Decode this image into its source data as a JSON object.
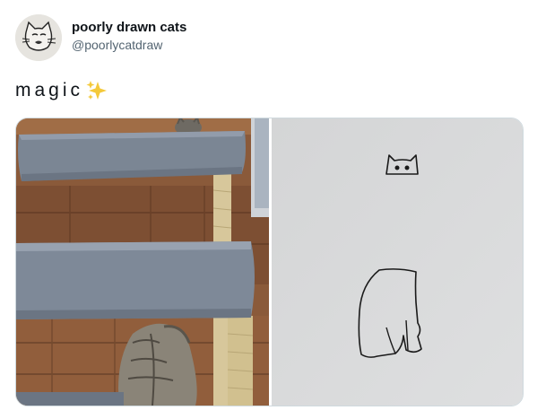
{
  "author": {
    "display_name": "poorly drawn cats",
    "handle": "@poorlycatdraw",
    "avatar_icon": "cat-face-drawing-icon"
  },
  "tweet": {
    "text": "magic",
    "emoji_icon": "sparkles-icon"
  },
  "media": {
    "left_photo": "cat-tree-photo",
    "right_photo": "cat-line-drawing",
    "colors": {
      "wood": "#8a5a3a",
      "carpet": "#7b8694",
      "paper": "#d9dadb",
      "sparkle": "#f4c93a"
    }
  }
}
